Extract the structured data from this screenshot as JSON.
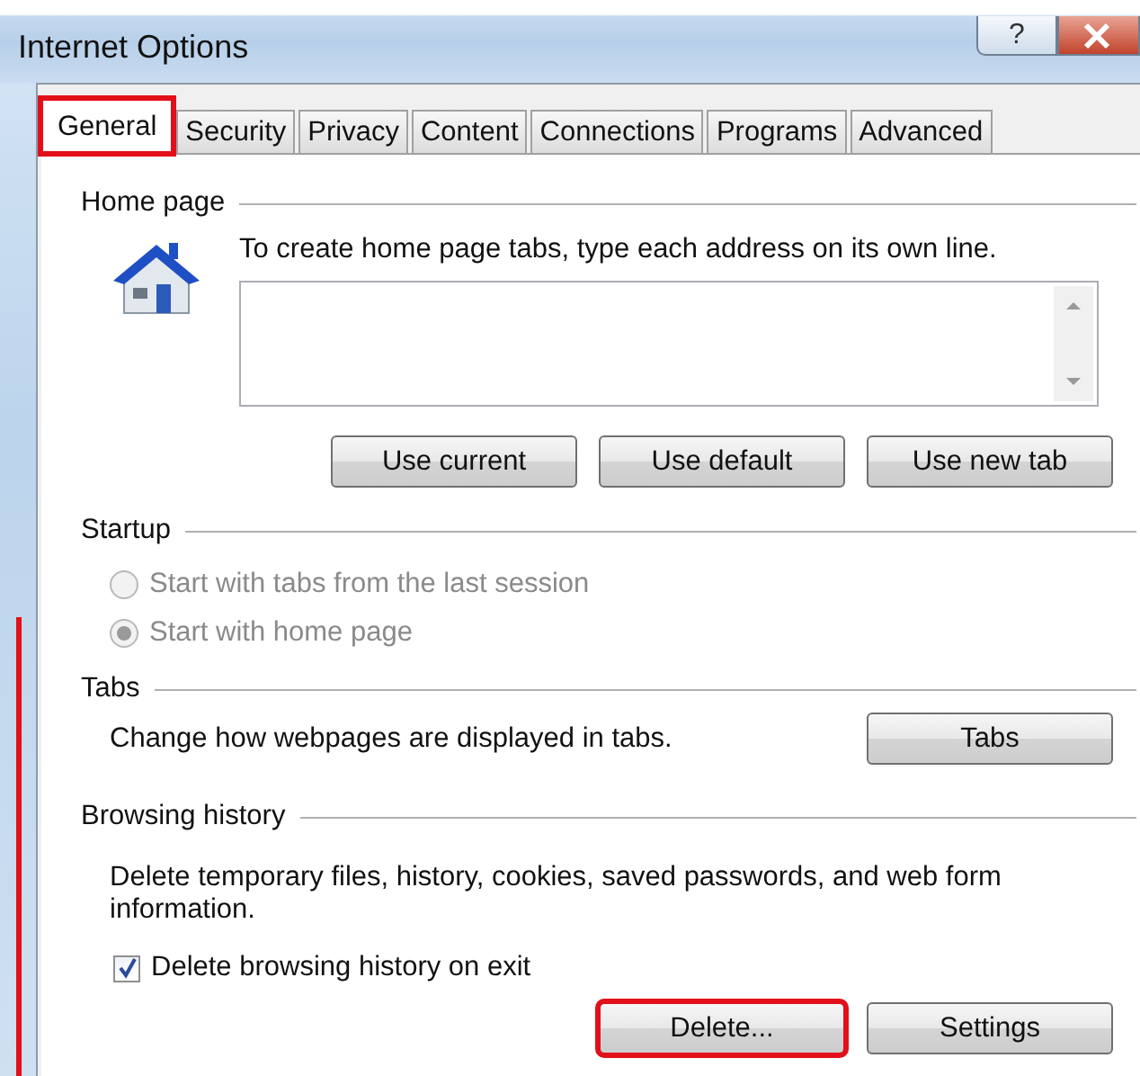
{
  "window": {
    "title": "Internet Options",
    "help_button": "?"
  },
  "tabs": [
    {
      "label": "General",
      "selected": true,
      "highlighted": true
    },
    {
      "label": "Security",
      "selected": false,
      "highlighted": false
    },
    {
      "label": "Privacy",
      "selected": false,
      "highlighted": false
    },
    {
      "label": "Content",
      "selected": false,
      "highlighted": false
    },
    {
      "label": "Connections",
      "selected": false,
      "highlighted": false
    },
    {
      "label": "Programs",
      "selected": false,
      "highlighted": false
    },
    {
      "label": "Advanced",
      "selected": false,
      "highlighted": false
    }
  ],
  "home_page": {
    "heading": "Home page",
    "instruction": "To create home page tabs, type each address on its own line.",
    "buttons": [
      {
        "label": "Use current",
        "highlighted": false
      },
      {
        "label": "Use default",
        "highlighted": false
      },
      {
        "label": "Use new tab",
        "highlighted": false
      }
    ]
  },
  "startup": {
    "heading": "Startup",
    "options": [
      {
        "label": "Start with tabs from the last session",
        "selected": false,
        "disabled": true
      },
      {
        "label": "Start with home page",
        "selected": true,
        "disabled": true
      }
    ]
  },
  "tabs_section": {
    "heading": "Tabs",
    "description": "Change how webpages are displayed in tabs.",
    "button": {
      "label": "Tabs",
      "highlighted": false
    }
  },
  "browsing_history": {
    "heading": "Browsing history",
    "description": "Delete temporary files, history, cookies, saved passwords, and web form information.",
    "checkbox": {
      "label": "Delete browsing history on exit",
      "checked": true
    },
    "buttons": [
      {
        "label": "Delete...",
        "highlighted": true
      },
      {
        "label": "Settings",
        "highlighted": false
      }
    ]
  }
}
